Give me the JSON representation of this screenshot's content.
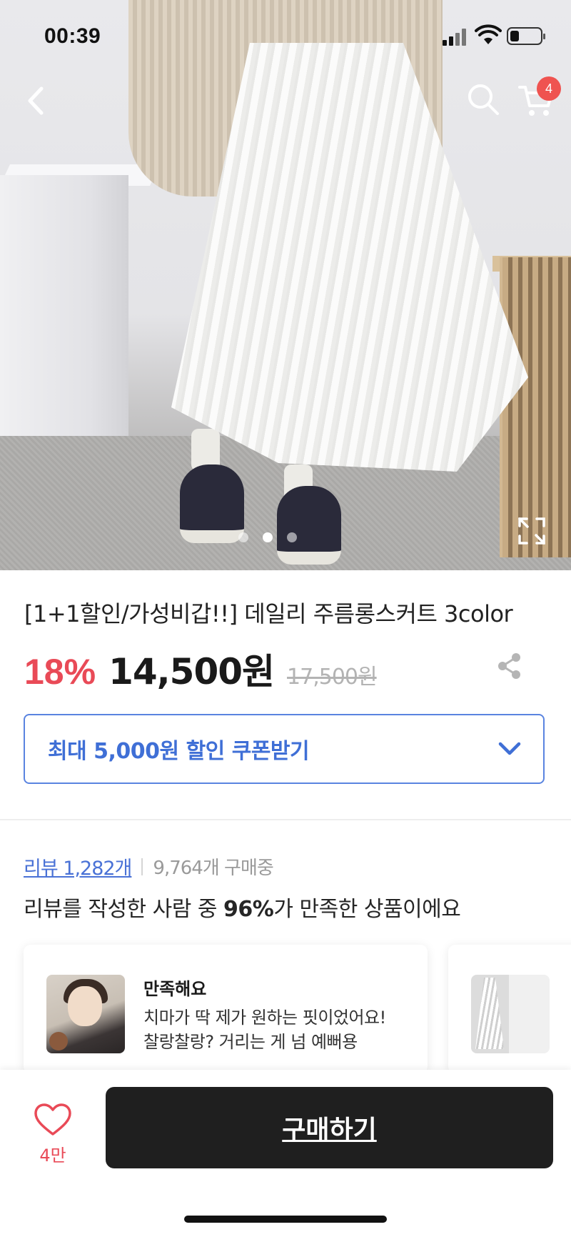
{
  "status_bar": {
    "time": "00:39"
  },
  "nav": {
    "cart_badge": "4"
  },
  "gallery": {
    "dot_count": 3,
    "active_index": 1
  },
  "product": {
    "title": "[1+1할인/가성비갑!!] 데일리 주름롱스커트 3color",
    "discount": "18%",
    "price": "14,500원",
    "original_price": "17,500원"
  },
  "coupon": {
    "label": "최대 5,000원 할인 쿠폰받기"
  },
  "reviews": {
    "review_link": "리뷰 1,282개",
    "buying": "9,764개 구매중",
    "satisfaction_prefix": "리뷰를 작성한 사람 중 ",
    "satisfaction_value": "96%",
    "satisfaction_suffix": "가 만족한 상품이에요",
    "cards": [
      {
        "title": "만족해요",
        "line1": "치마가 딱 제가 원하는 핏이었어요!",
        "line2": "찰랑찰랑? 거리는 게 넘 예뻐용"
      }
    ]
  },
  "bottom_bar": {
    "like_count": "4만",
    "buy_label": "구매하기"
  },
  "colors": {
    "accent_red": "#e94a57",
    "accent_blue": "#3f6fd6",
    "buy_button": "#1f1f1f"
  }
}
